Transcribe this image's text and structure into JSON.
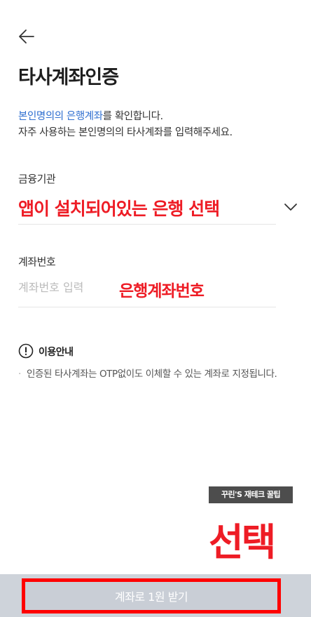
{
  "header": {
    "title": "타사계좌인증"
  },
  "description": {
    "line1_highlight": "본인명의의 은행계좌",
    "line1_rest": "를 확인합니다.",
    "line2": "자주 사용하는 본인명의의 타사계좌를 입력해주세요."
  },
  "bank_field": {
    "label": "금융기관",
    "annotation": "앱이 설치되어있는 은행 선택"
  },
  "account_field": {
    "label": "계좌번호",
    "placeholder": "계좌번호 입력",
    "annotation": "은행계좌번호"
  },
  "info": {
    "title": "이용안내",
    "bullet": "·",
    "text": "인증된 타사계좌는 OTP없이도 이체할 수 있는 계좌로 지정됩니다."
  },
  "watermark": "꾸린'S 재테크 꿀팁",
  "select_annotation": "선택",
  "cta": {
    "label": "계좌로 1원 받기"
  },
  "colors": {
    "accent_blue": "#2f6fd0",
    "annotation_red": "#ee1c25",
    "button_gray": "#c9ced6"
  }
}
